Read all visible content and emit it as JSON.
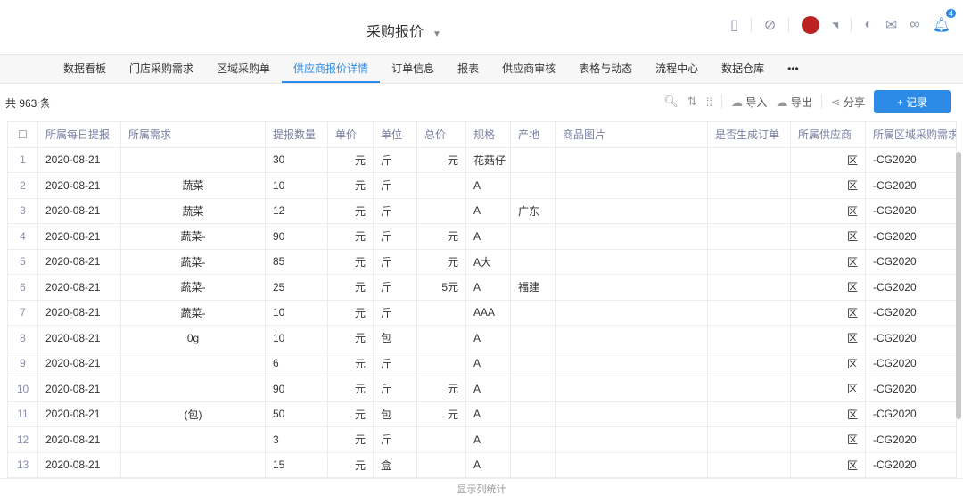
{
  "header": {
    "title": "采购报价",
    "notif_count": "4"
  },
  "nav": [
    "数据看板",
    "门店采购需求",
    "区域采购单",
    "供应商报价详情",
    "订单信息",
    "报表",
    "供应商审核",
    "表格与动态",
    "流程中心",
    "数据仓库",
    "•••"
  ],
  "toolbar": {
    "count": "共 963 条",
    "import": "导入",
    "export": "导出",
    "share": "分享",
    "add": "+ 记录"
  },
  "columns": [
    "所属每日提报",
    "所属需求",
    "提报数量",
    "单价",
    "单位",
    "总价",
    "规格",
    "产地",
    "商品图片",
    "是否生成订单",
    "所属供应商",
    "所属区域采购需求"
  ],
  "rows": [
    [
      "1",
      "2020-08-21",
      "",
      "30",
      "元",
      "斤",
      "元",
      "花菇仔",
      "",
      "",
      "",
      "区",
      "-CG2020"
    ],
    [
      "2",
      "2020-08-21",
      "蔬菜",
      "10",
      "元",
      "斤",
      "",
      "A",
      "",
      "",
      "",
      "区",
      "-CG2020"
    ],
    [
      "3",
      "2020-08-21",
      "蔬菜",
      "12",
      "元",
      "斤",
      "",
      "A",
      "广东",
      "",
      "",
      "区",
      "-CG2020"
    ],
    [
      "4",
      "2020-08-21",
      "蔬菜-",
      "90",
      "元",
      "斤",
      "元",
      "A",
      "",
      "",
      "",
      "区",
      "-CG2020"
    ],
    [
      "5",
      "2020-08-21",
      "蔬菜-",
      "85",
      "元",
      "斤",
      "元",
      "A大",
      "",
      "",
      "",
      "区",
      "-CG2020"
    ],
    [
      "6",
      "2020-08-21",
      "蔬菜-",
      "25",
      "元",
      "斤",
      "5元",
      "A",
      "福建",
      "",
      "",
      "区",
      "-CG2020"
    ],
    [
      "7",
      "2020-08-21",
      "蔬菜-",
      "10",
      "元",
      "斤",
      "",
      "AAA",
      "",
      "",
      "",
      "区",
      "-CG2020"
    ],
    [
      "8",
      "2020-08-21",
      "0g",
      "10",
      "元",
      "包",
      "",
      "A",
      "",
      "",
      "",
      "区",
      "-CG2020"
    ],
    [
      "9",
      "2020-08-21",
      "",
      "6",
      "元",
      "斤",
      "",
      "A",
      "",
      "",
      "",
      "区",
      "-CG2020"
    ],
    [
      "10",
      "2020-08-21",
      "",
      "90",
      "元",
      "斤",
      "元",
      "A",
      "",
      "",
      "",
      "区",
      "-CG2020"
    ],
    [
      "11",
      "2020-08-21",
      "(包)",
      "50",
      "元",
      "包",
      "元",
      "A",
      "",
      "",
      "",
      "区",
      "-CG2020"
    ],
    [
      "12",
      "2020-08-21",
      "",
      "3",
      "元",
      "斤",
      "",
      "A",
      "",
      "",
      "",
      "区",
      "-CG2020"
    ],
    [
      "13",
      "2020-08-21",
      "",
      "15",
      "元",
      "盒",
      "",
      "A",
      "",
      "",
      "",
      "区",
      "-CG2020"
    ]
  ],
  "footer": "显示列统计"
}
